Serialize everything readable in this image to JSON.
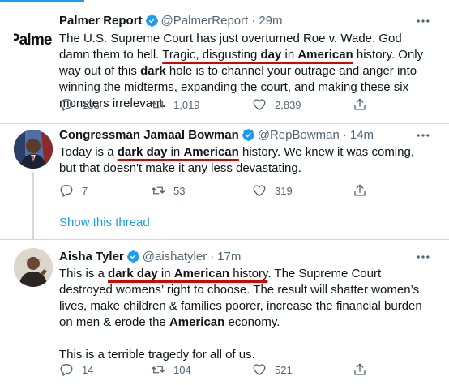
{
  "tweets": [
    {
      "logo_text": "Palmer",
      "name": "Palmer Report",
      "handle": "@PalmerReport",
      "time": "29m",
      "text": {
        "a": "The U.S. Supreme Court has just overturned Roe v. Wade. God damn them to hell. ",
        "u1": "Tragic, disgusting ",
        "u1b": "day",
        "u2": " in ",
        "u2b": "American",
        "b": " history. Only way out of this ",
        "bold": "dark",
        "c": " hole is to channel your outrage and anger into winning the midterms, expanding the court, and making these six monsters irrelevant."
      },
      "replies": "133",
      "retweets": "1,019",
      "likes": "2,839"
    },
    {
      "name": "Congressman Jamaal Bowman",
      "handle": "@RepBowman",
      "time": "14m",
      "text": {
        "a": "Today is a ",
        "u1": "dark day",
        "u2": " in ",
        "u3": "American",
        "b": " history. We knew it was coming, but that doesn't make it any less devastating."
      },
      "replies": "7",
      "retweets": "53",
      "likes": "319"
    },
    {
      "name": "Aisha Tyler",
      "handle": "@aishatyler",
      "time": "17m",
      "text": {
        "a": "This is a ",
        "u1": "dark day",
        "u2": " in ",
        "u3": "American",
        "u4": " history",
        "b": ". The Supreme Court destroyed womens’ right to choose. The result will shatter women’s lives, make children & families poorer, increase the financial burden on men & erode the ",
        "bold": "American",
        "c": " economy.",
        "p2": "This is a terrible tragedy for all of us."
      },
      "replies": "14",
      "retweets": "104",
      "likes": "521"
    }
  ],
  "show_thread": "Show this thread",
  "colors": {
    "accent": "#1d9bf0",
    "underline": "#d90000",
    "muted": "#536471"
  }
}
